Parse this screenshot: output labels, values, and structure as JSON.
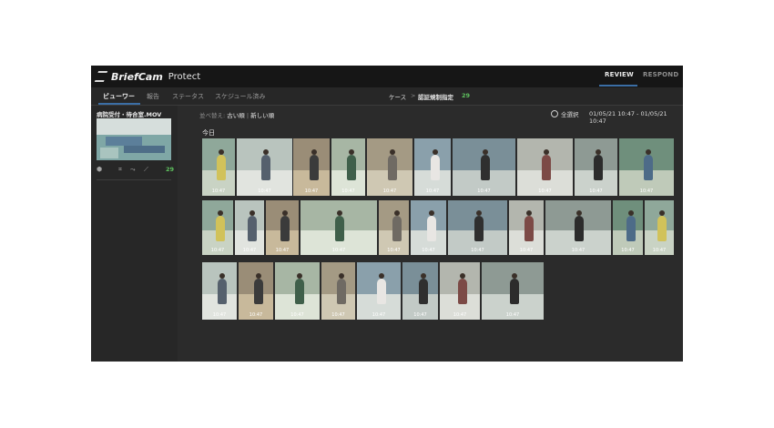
{
  "topbar": {
    "brand": "BriefCam",
    "product": "Protect",
    "tabs": [
      {
        "label": "REVIEW",
        "active": true
      },
      {
        "label": "RESPOND",
        "active": false
      }
    ]
  },
  "subnav": {
    "tabs": [
      {
        "label": "ビューワー",
        "active": true
      },
      {
        "label": "報告"
      },
      {
        "label": "ステータス"
      },
      {
        "label": "スケジュール済み"
      }
    ],
    "breadcrumb": {
      "case": "ケース",
      "separator": ">",
      "rule": "認証規制指定",
      "count": "29"
    }
  },
  "sidebar": {
    "file_name": "病院受付・待合室.MOV",
    "icons": [
      "cube-icon",
      "crop-icon",
      "route-icon",
      "line-icon"
    ],
    "count": "29"
  },
  "main": {
    "sort": {
      "label": "並べ替え:",
      "oldest": "古い順",
      "separator": "|",
      "newest": "新しい順"
    },
    "select_all": "全選択",
    "date_range": "01/05/21 10:47 - 01/05/21 10:47",
    "section_title": "今日",
    "clips": [
      {
        "time": "10:47"
      },
      {
        "time": "10:47"
      },
      {
        "time": "10:47"
      },
      {
        "time": "10:47"
      },
      {
        "time": "10:47"
      },
      {
        "time": "10:47"
      },
      {
        "time": "10:47"
      },
      {
        "time": "10:47"
      },
      {
        "time": "10:47"
      },
      {
        "time": "10:47"
      },
      {
        "time": "10:47"
      },
      {
        "time": "10:47"
      },
      {
        "time": "10:47"
      },
      {
        "time": "10:47"
      },
      {
        "time": "10:47"
      },
      {
        "time": "10:47"
      },
      {
        "time": "10:47"
      },
      {
        "time": "10:47"
      },
      {
        "time": "10:47"
      },
      {
        "time": "10:47"
      },
      {
        "time": "10:47"
      },
      {
        "time": "10:47"
      },
      {
        "time": "10:47"
      },
      {
        "time": "10:47"
      },
      {
        "time": "10:47"
      },
      {
        "time": "10:47"
      },
      {
        "time": "10:47"
      },
      {
        "time": "10:47"
      },
      {
        "time": "10:47"
      }
    ]
  },
  "colors": {
    "accent_blue": "#3b6ea5",
    "count_green": "#5fc35f",
    "panel_bg": "#2b2b2b",
    "topbar_bg": "#161616"
  }
}
